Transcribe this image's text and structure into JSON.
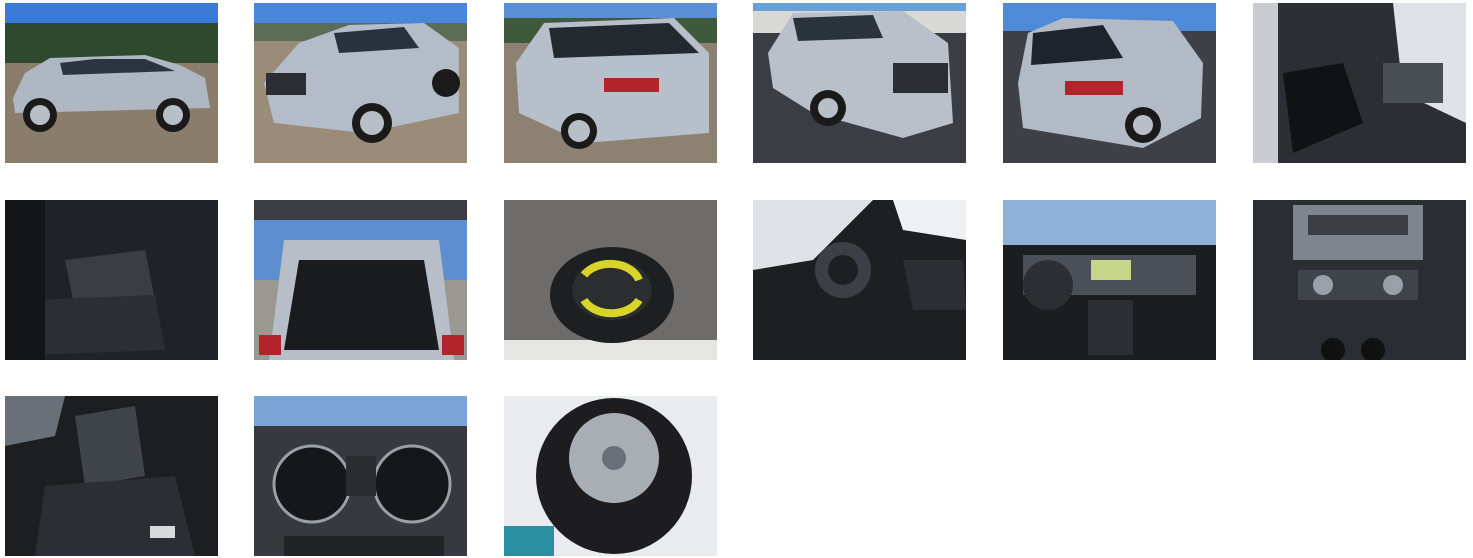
{
  "gallery": {
    "photos": [
      {
        "subject": "exterior-side",
        "sky": "#3b7bd8",
        "ground": "#8b7d6b",
        "car": "#aeb7c2"
      },
      {
        "subject": "exterior-front-quarter",
        "sky": "#4a86d9",
        "ground": "#9a8c79",
        "car": "#b3bcc8"
      },
      {
        "subject": "exterior-rear-quarter",
        "sky": "#5a8fd6",
        "ground": "#8d8172",
        "car": "#b6bfca"
      },
      {
        "subject": "exterior-front",
        "sky": "#6aa0d8",
        "ground": "#3a3d44",
        "car": "#b9c0ca"
      },
      {
        "subject": "exterior-rear",
        "sky": "#4f8ad9",
        "ground": "#3d4047",
        "car": "#b1bac5"
      },
      {
        "subject": "interior-driver-seat",
        "sky": "#2b2e33",
        "ground": "#111214",
        "car": "#4a4e55"
      },
      {
        "subject": "interior-rear-seats",
        "sky": "#1f2226",
        "ground": "#141518",
        "car": "#3a3e44"
      },
      {
        "subject": "open-trunk",
        "sky": "#5d8fd0",
        "ground": "#9a9891",
        "car": "#b7bec8"
      },
      {
        "subject": "spare-wheel",
        "sky": "#6d6c6a",
        "ground": "#2a2b2d",
        "car": "#d9d42a"
      },
      {
        "subject": "interior-dashboard-side",
        "sky": "#dfe3e8",
        "ground": "#1d1f22",
        "car": "#3c4046"
      },
      {
        "subject": "interior-dashboard-front",
        "sky": "#8fb0d8",
        "ground": "#1b1d21",
        "car": "#4b5058"
      },
      {
        "subject": "center-console",
        "sky": "#2a2d31",
        "ground": "#18191c",
        "car": "#7f858e"
      },
      {
        "subject": "interior-rear-seat-detail",
        "sky": "#1c1e22",
        "ground": "#0f1012",
        "car": "#3f434a"
      },
      {
        "subject": "instrument-cluster",
        "sky": "#36393e",
        "ground": "#15171a",
        "car": "#9aa0a8"
      },
      {
        "subject": "winter-tires",
        "sky": "#e9ebee",
        "ground": "#1d1d1f",
        "car": "#a9aeb5"
      }
    ]
  }
}
